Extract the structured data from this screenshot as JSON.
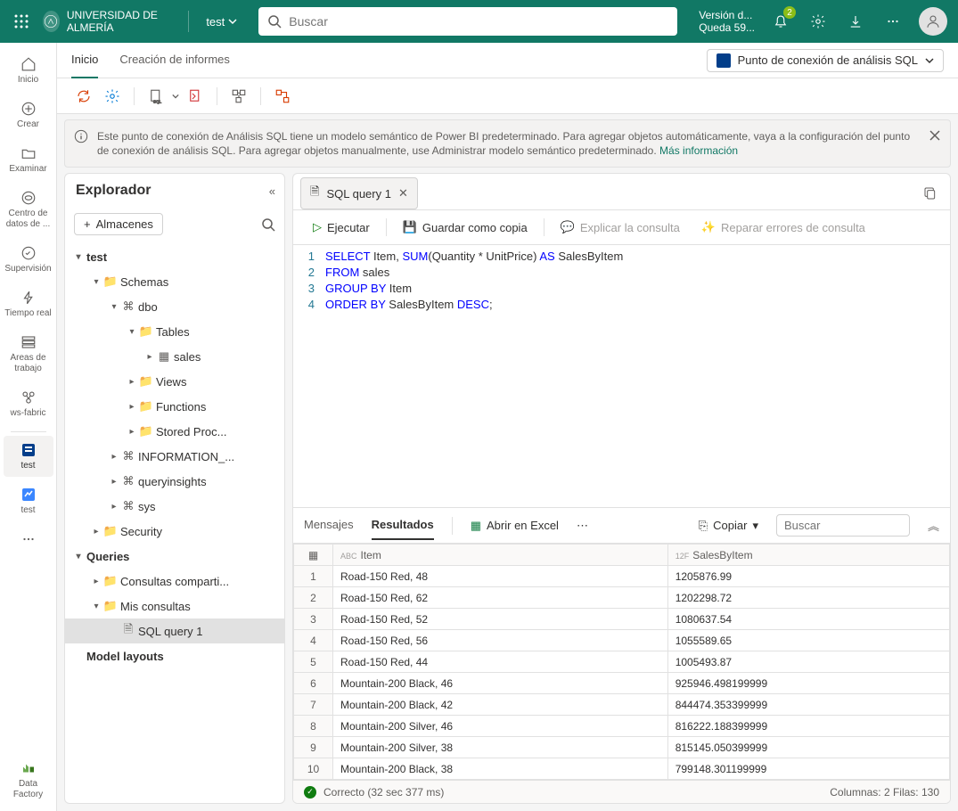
{
  "topbar": {
    "org": "UNIVERSIDAD DE ALMERÍA",
    "workspace": "test",
    "search_placeholder": "Buscar",
    "version_l1": "Versión d...",
    "version_l2": "Queda 59...",
    "notif_count": "2"
  },
  "leftrail": {
    "items": [
      {
        "label": "Inicio"
      },
      {
        "label": "Crear"
      },
      {
        "label": "Examinar"
      },
      {
        "label": "Centro de datos de ..."
      },
      {
        "label": "Supervisión"
      },
      {
        "label": "Tiempo real"
      },
      {
        "label": "Áreas de trabajo"
      },
      {
        "label": "ws-fabric"
      },
      {
        "label": "test"
      },
      {
        "label": "test"
      }
    ],
    "more": "...",
    "bottom": "Data Factory"
  },
  "tabs": {
    "home": "Inicio",
    "reports": "Creación de informes",
    "endpoint": "Punto de conexión de análisis SQL"
  },
  "infobar": {
    "text": "Este punto de conexión de Análisis SQL tiene un modelo semántico de Power BI predeterminado. Para agregar objetos automáticamente, vaya a la configuración del punto de conexión de análisis SQL. Para agregar objetos manualmente, use Administrar modelo semántico predeterminado.",
    "link": "Más información"
  },
  "explorer": {
    "title": "Explorador",
    "stores": "Almacenes",
    "tree": {
      "db": "test",
      "schemas": "Schemas",
      "dbo": "dbo",
      "tables": "Tables",
      "sales": "sales",
      "views": "Views",
      "functions": "Functions",
      "sprocs": "Stored Proc...",
      "infoschema": "INFORMATION_...",
      "queryinsights": "queryinsights",
      "sys": "sys",
      "security": "Security",
      "queries": "Queries",
      "shared": "Consultas comparti...",
      "mine": "Mis consultas",
      "sql1": "SQL query 1",
      "layouts": "Model layouts"
    }
  },
  "editor": {
    "tab": "SQL query 1",
    "run": "Ejecutar",
    "savecopy": "Guardar como copia",
    "explain": "Explicar la consulta",
    "fix": "Reparar errores de consulta",
    "code": {
      "l1_select": "SELECT",
      "l1_rest": " Item, ",
      "l1_sum": "SUM",
      "l1_args": "(Quantity * UnitPrice) ",
      "l1_as": "AS",
      "l1_alias": " SalesByItem",
      "l2_from": "FROM",
      "l2_table": " sales",
      "l3_group": "GROUP",
      "l3_by": " BY",
      "l3_col": " Item",
      "l4_order": "ORDER",
      "l4_by": " BY",
      "l4_col": " SalesByItem ",
      "l4_desc": "DESC",
      "l4_end": ";"
    },
    "lines": [
      "1",
      "2",
      "3",
      "4"
    ]
  },
  "results": {
    "msg_tab": "Mensajes",
    "res_tab": "Resultados",
    "excel": "Abrir en Excel",
    "copy": "Copiar",
    "search": "Buscar",
    "cols": {
      "item_type": "ABC",
      "item": "Item",
      "sales_type": "12F",
      "sales": "SalesByItem"
    },
    "rows": [
      {
        "n": "1",
        "item": "Road-150 Red, 48",
        "val": "1205876.99"
      },
      {
        "n": "2",
        "item": "Road-150 Red, 62",
        "val": "1202298.72"
      },
      {
        "n": "3",
        "item": "Road-150 Red, 52",
        "val": "1080637.54"
      },
      {
        "n": "4",
        "item": "Road-150 Red, 56",
        "val": "1055589.65"
      },
      {
        "n": "5",
        "item": "Road-150 Red, 44",
        "val": "1005493.87"
      },
      {
        "n": "6",
        "item": "Mountain-200 Black, 46",
        "val": "925946.498199999"
      },
      {
        "n": "7",
        "item": "Mountain-200 Black, 42",
        "val": "844474.353399999"
      },
      {
        "n": "8",
        "item": "Mountain-200 Silver, 46",
        "val": "816222.188399999"
      },
      {
        "n": "9",
        "item": "Mountain-200 Silver, 38",
        "val": "815145.050399999"
      },
      {
        "n": "10",
        "item": "Mountain-200 Black, 38",
        "val": "799148.301199999"
      }
    ]
  },
  "status": {
    "ok": "Correcto (32 sec 377 ms)",
    "right": "Columnas: 2 Filas: 130"
  }
}
